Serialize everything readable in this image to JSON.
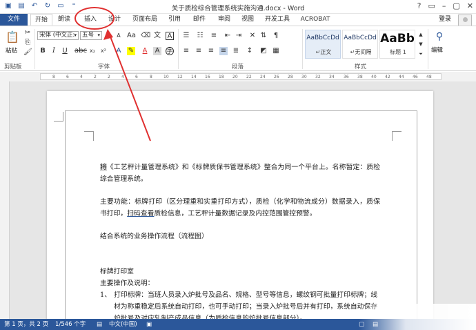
{
  "window": {
    "title": "关于质检综合管理系统实施沟通.docx - Word"
  },
  "tabs": {
    "file": "文件",
    "home": "开始",
    "review_trimmed": "朗读",
    "insert": "插入",
    "design": "设计",
    "layout": "页面布局",
    "references": "引用",
    "mailings": "邮件",
    "review": "审阅",
    "view": "视图",
    "developer": "开发工具",
    "acrobat": "ACROBAT",
    "login": "登录"
  },
  "ribbon": {
    "paste_label": "粘贴",
    "font_name": "宋体 (中文正:",
    "font_size": "五号",
    "groups": {
      "clipboard": "剪贴板",
      "font": "字体",
      "paragraph": "段落",
      "styles": "样式",
      "editing": "编辑"
    },
    "styles": [
      {
        "sample": "AaBbCcDd",
        "name": "↵正文"
      },
      {
        "sample": "AaBbCcDd",
        "name": "↵无间隔"
      },
      {
        "sample": "AaBb",
        "name": "标题 1"
      }
    ]
  },
  "ruler": {
    "ticks": [
      "8",
      "6",
      "4",
      "2",
      "2",
      "4",
      "6",
      "8",
      "10",
      "12",
      "14",
      "16",
      "18",
      "20",
      "22",
      "24",
      "26",
      "28",
      "30",
      "32",
      "34",
      "36",
      "38",
      "40",
      "42",
      "44",
      "46",
      "48"
    ]
  },
  "document": {
    "p1_start": "将",
    "p1_rest": "《工艺秤计量管理系统》和《标牌质保书管理系统》整合为同一个平台上。名称暂定：质检综合管理系统。",
    "p2_a": "主要功能：标牌打印（区分理重和实重打印方式），质检（化学和物流成分）数据录入，质保书打印，",
    "p2_link": "扫码查看",
    "p2_b": "质检信息，工艺秤计量数据记录及内控范围管控预警。",
    "p3": "结合系统的业务操作流程（流程图）",
    "p4": "标牌打印室",
    "p5": "主要操作及说明：",
    "list_num": "1、",
    "list_text": "打印标牌：当班人员录入炉批号及品名、规格、型号等信息，螺纹钢可批量打印标牌；线材为称重稳定后系统自动打印，也可手动打印；当录入炉批号后并有打印，系统自动保存炉批号及对应轧制产成品信息（为质检信息的炉批号信息部分）。"
  },
  "status": {
    "page": "第 1 页，共 2 页",
    "words": "1/546 个字",
    "lang": "中文(中国)"
  },
  "colors": {
    "accent": "#2b579a",
    "annotation": "#e03030"
  }
}
